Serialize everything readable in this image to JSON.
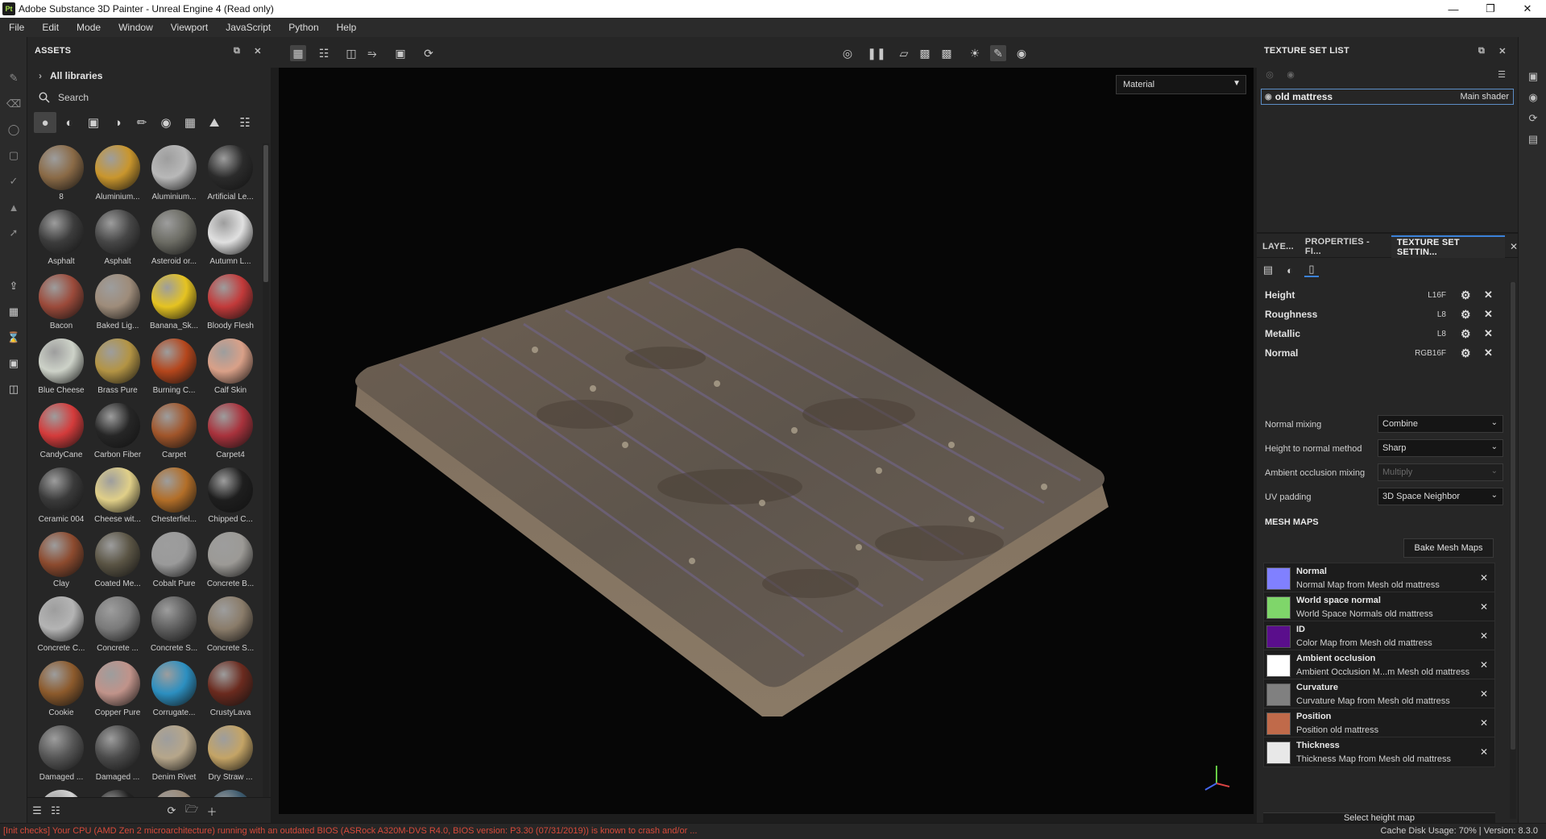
{
  "window": {
    "title": "Adobe Substance 3D Painter - Unreal Engine 4 (Read only)",
    "app_icon": "Pt"
  },
  "menu": [
    "File",
    "Edit",
    "Mode",
    "Window",
    "Viewport",
    "JavaScript",
    "Python",
    "Help"
  ],
  "assets": {
    "title": "ASSETS",
    "all_libraries": "All libraries",
    "search_placeholder": "Search",
    "items": [
      {
        "label": "8",
        "color": "#8a6a46"
      },
      {
        "label": "Aluminium...",
        "color": "#c9962d"
      },
      {
        "label": "Aluminium...",
        "color": "#b8b8b8"
      },
      {
        "label": "Artificial Le...",
        "color": "#2b2b2b"
      },
      {
        "label": "Asphalt",
        "color": "#3c3c3c"
      },
      {
        "label": "Asphalt",
        "color": "#464646"
      },
      {
        "label": "Asteroid or...",
        "color": "#6c6c64"
      },
      {
        "label": "Autumn L...",
        "color": "#e0e0e0"
      },
      {
        "label": "Bacon",
        "color": "#9b4a3a"
      },
      {
        "label": "Baked Lig...",
        "color": "#9e8c7a"
      },
      {
        "label": "Banana_Sk...",
        "color": "#e5c321"
      },
      {
        "label": "Bloody Flesh",
        "color": "#c23a3a"
      },
      {
        "label": "Blue Cheese",
        "color": "#cdd2c8"
      },
      {
        "label": "Brass Pure",
        "color": "#b39444"
      },
      {
        "label": "Burning C...",
        "color": "#b4461c"
      },
      {
        "label": "Calf Skin",
        "color": "#d9a088"
      },
      {
        "label": "CandyCane",
        "color": "#d43b3b"
      },
      {
        "label": "Carbon Fiber",
        "color": "#262626"
      },
      {
        "label": "Carpet",
        "color": "#a0552a"
      },
      {
        "label": "Carpet4",
        "color": "#a8323c"
      },
      {
        "label": "Ceramic 004",
        "color": "#3a3a3a"
      },
      {
        "label": "Cheese wit...",
        "color": "#e0cf88"
      },
      {
        "label": "Chesterfiel...",
        "color": "#b26e28"
      },
      {
        "label": "Chipped C...",
        "color": "#1e1e1e"
      },
      {
        "label": "Clay",
        "color": "#8c4a2e"
      },
      {
        "label": "Coated Me...",
        "color": "#5a5444"
      },
      {
        "label": "Cobalt Pure",
        "color": "#9a9a9a"
      },
      {
        "label": "Concrete B...",
        "color": "#9c9a96"
      },
      {
        "label": "Concrete C...",
        "color": "#b4b4b4"
      },
      {
        "label": "Concrete ...",
        "color": "#7a7a7a"
      },
      {
        "label": "Concrete S...",
        "color": "#5e5e5e"
      },
      {
        "label": "Concrete S...",
        "color": "#8a7c6a"
      },
      {
        "label": "Cookie",
        "color": "#8c5a2c"
      },
      {
        "label": "Copper Pure",
        "color": "#c0938a"
      },
      {
        "label": "Corrugate...",
        "color": "#2c8fc0"
      },
      {
        "label": "CrustyLava",
        "color": "#6a2a1e"
      },
      {
        "label": "Damaged ...",
        "color": "#555555"
      },
      {
        "label": "Damaged ...",
        "color": "#4a4a4a"
      },
      {
        "label": "Denim Rivet",
        "color": "#b6a68a"
      },
      {
        "label": "Dry Straw ...",
        "color": "#c4a466"
      },
      {
        "label": "",
        "color": "#d4d4d4"
      },
      {
        "label": "",
        "color": "#222222"
      },
      {
        "label": "",
        "color": "#9a8a78"
      },
      {
        "label": "",
        "color": "#3c5a6e"
      }
    ]
  },
  "viewport": {
    "material_mode": "Material"
  },
  "texture_set_list": {
    "title": "TEXTURE SET LIST",
    "item": {
      "name": "old mattress",
      "shader": "Main shader"
    }
  },
  "settings": {
    "tabs": [
      "LAYE...",
      "PROPERTIES - FI...",
      "TEXTURE SET SETTIN..."
    ],
    "channels": [
      {
        "name": "Height",
        "format": "L16F"
      },
      {
        "name": "Roughness",
        "format": "L8"
      },
      {
        "name": "Metallic",
        "format": "L8"
      },
      {
        "name": "Normal",
        "format": "RGB16F"
      }
    ],
    "normal_mixing": {
      "label": "Normal mixing",
      "value": "Combine"
    },
    "height_to_normal": {
      "label": "Height to normal method",
      "value": "Sharp"
    },
    "ao_mixing": {
      "label": "Ambient occlusion mixing",
      "value": "Multiply"
    },
    "uv_padding": {
      "label": "UV padding",
      "value": "3D Space Neighbor"
    },
    "mesh_maps_title": "MESH MAPS",
    "bake_button": "Bake Mesh Maps",
    "mesh_maps": [
      {
        "name": "Normal",
        "desc": "Normal Map from Mesh old mattress",
        "color": "#8080ff"
      },
      {
        "name": "World space normal",
        "desc": "World Space Normals old mattress",
        "color": "#7fd66a"
      },
      {
        "name": "ID",
        "desc": "Color Map from Mesh old mattress",
        "color": "#5a0e8c"
      },
      {
        "name": "Ambient occlusion",
        "desc": "Ambient Occlusion M...m Mesh old mattress",
        "color": "#ffffff"
      },
      {
        "name": "Curvature",
        "desc": "Curvature Map from Mesh old mattress",
        "color": "#808080"
      },
      {
        "name": "Position",
        "desc": "Position old mattress",
        "color": "#c06a4a"
      },
      {
        "name": "Thickness",
        "desc": "Thickness Map from Mesh old mattress",
        "color": "#e8e8e8"
      }
    ],
    "select_height": "Select height map"
  },
  "status": {
    "warning": "[Init checks] Your CPU (AMD Zen 2 microarchitecture) running with an outdated BIOS (ASRock A320M-DVS R4.0, BIOS version: P3.30 (07/31/2019)) is known to crash and/or ...",
    "cache": "Cache Disk Usage:   70% | Version: 8.3.0"
  }
}
